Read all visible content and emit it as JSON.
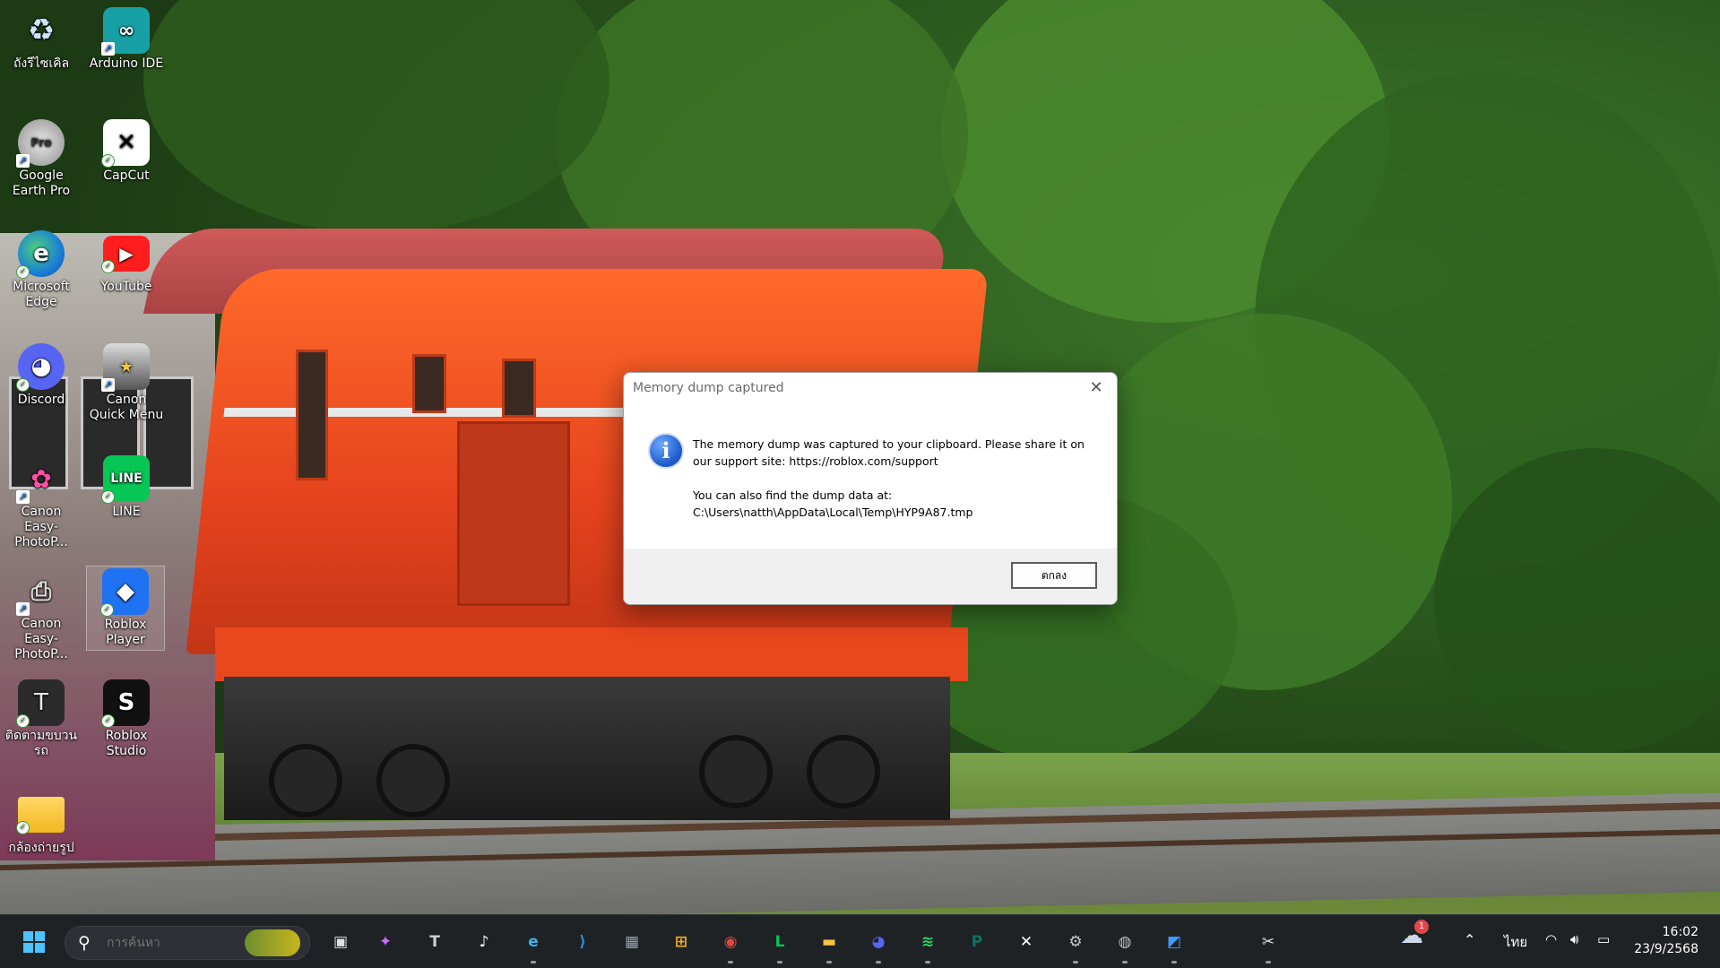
{
  "desktop": {
    "icons": [
      {
        "label": "ถังรีไซเคิล",
        "icon": "recycle-bin-icon"
      },
      {
        "label": "Arduino IDE",
        "icon": "arduino-icon"
      },
      {
        "label": "Google Earth Pro",
        "icon": "google-earth-icon",
        "badge": "Pro"
      },
      {
        "label": "CapCut",
        "icon": "capcut-icon"
      },
      {
        "label": "Microsoft Edge",
        "icon": "edge-icon"
      },
      {
        "label": "YouTube",
        "icon": "youtube-icon"
      },
      {
        "label": "Discord",
        "icon": "discord-icon"
      },
      {
        "label": "Canon Quick Menu",
        "icon": "canon-quick-menu-icon"
      },
      {
        "label": "Canon Easy-PhotoP...",
        "icon": "canon-easy-photoprint-icon"
      },
      {
        "label": "LINE",
        "icon": "line-icon",
        "glyph": "LINE"
      },
      {
        "label": "Canon Easy-PhotoP...",
        "icon": "canon-easy-photoprint-icon"
      },
      {
        "label": "Roblox Player",
        "icon": "roblox-player-icon"
      },
      {
        "label": "ติดตามขบวนรถ",
        "icon": "train-tracker-icon",
        "glyph": "T"
      },
      {
        "label": "Roblox Studio",
        "icon": "roblox-studio-icon"
      },
      {
        "label": "กล้องถ่ายรูป",
        "icon": "folder-icon"
      }
    ]
  },
  "dialog": {
    "title": "Memory dump captured",
    "close_glyph": "✕",
    "info_glyph": "i",
    "message_line1": "The memory dump was captured to your clipboard. Please share it on our support site: https://roblox.com/support",
    "message_line2": "You can also find the dump data at: C:\\Users\\natth\\AppData\\Local\\Temp\\HYP9A87.tmp",
    "ok_label": "ตกลง"
  },
  "taskbar": {
    "search_placeholder": "การค้นหา",
    "pinned": [
      {
        "name": "task-view",
        "glyph": "▣",
        "color": "#e0e0e0"
      },
      {
        "name": "copilot",
        "glyph": "✦",
        "color": "#c86dff"
      },
      {
        "name": "tracker",
        "glyph": "T",
        "color": "#d0d0d0"
      },
      {
        "name": "tiktok",
        "glyph": "♪",
        "color": "#ffffff"
      },
      {
        "name": "edge",
        "glyph": "e",
        "color": "#3bb3e8"
      },
      {
        "name": "vscode",
        "glyph": "⟩",
        "color": "#2d8ee0"
      },
      {
        "name": "calculator",
        "glyph": "▦",
        "color": "#9aa3ad"
      },
      {
        "name": "store",
        "glyph": "⊞",
        "color": "#f2b01e"
      },
      {
        "name": "chrome",
        "glyph": "◉",
        "color": "#e8453c"
      },
      {
        "name": "line",
        "glyph": "L",
        "color": "#06c755"
      },
      {
        "name": "file-explorer",
        "glyph": "▬",
        "color": "#f5c542"
      },
      {
        "name": "discord",
        "glyph": "◕",
        "color": "#5865f2"
      },
      {
        "name": "spotify",
        "glyph": "≋",
        "color": "#1ed760"
      },
      {
        "name": "publisher",
        "glyph": "P",
        "color": "#077568"
      },
      {
        "name": "capcut",
        "glyph": "✕",
        "color": "#ffffff"
      },
      {
        "name": "settings",
        "glyph": "⚙",
        "color": "#c8c8c8"
      },
      {
        "name": "google-earth",
        "glyph": "◍",
        "color": "#bdbdbd"
      },
      {
        "name": "paint",
        "glyph": "◩",
        "color": "#3d9bff"
      },
      {
        "name": "snipping-tool",
        "glyph": "✂",
        "color": "#e0e0e0"
      }
    ],
    "weather_badge": "1",
    "language": "ไทย",
    "time": "16:02",
    "date": "23/9/2568"
  }
}
